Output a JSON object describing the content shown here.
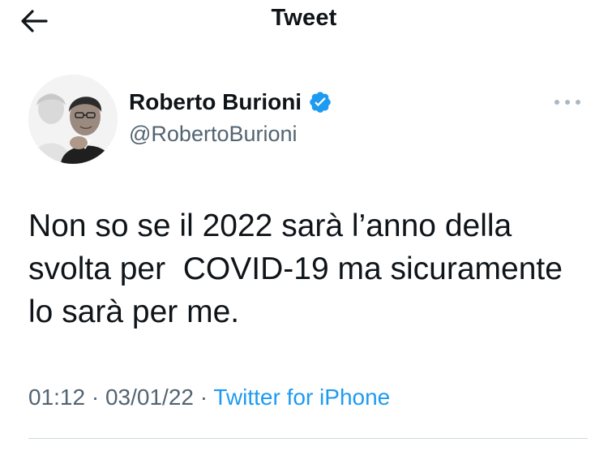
{
  "header": {
    "title": "Tweet",
    "back_icon": "arrow-left-icon"
  },
  "author": {
    "display_name": "Roberto Burioni",
    "handle": "@RobertoBurioni",
    "verified": true,
    "verified_icon": "verified-badge-icon",
    "avatar": "avatar"
  },
  "more_icon": "more-horizontal-icon",
  "tweet": {
    "text": "Non so se il 2022 sarà l’anno della svolta per  COVID-19 ma sicuramente lo sarà per me."
  },
  "meta": {
    "time": "01:12",
    "separator": "·",
    "date": "03/01/22",
    "source": "Twitter for iPhone"
  },
  "colors": {
    "accent": "#1d9bf0",
    "secondary_text": "#536471",
    "primary_text": "#0f1419",
    "divider": "#cfd9de"
  }
}
